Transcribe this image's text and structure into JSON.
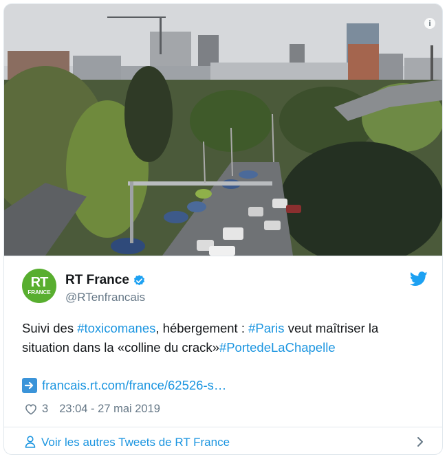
{
  "tweet": {
    "author_name": "RT France",
    "handle": "@RTenfrancais",
    "avatar_text_main": "RT",
    "avatar_text_sub": "FRANCE",
    "text_segments": [
      {
        "text": "Suivi des ",
        "type": "plain"
      },
      {
        "text": "#toxicomanes",
        "type": "hashtag"
      },
      {
        "text": ", hébergement : ",
        "type": "plain"
      },
      {
        "text": "#Paris",
        "type": "hashtag"
      },
      {
        "text": " veut maîtriser la situation dans la «colline du crack»",
        "type": "plain"
      },
      {
        "text": "#PortedeLaChapelle",
        "type": "hashtag"
      }
    ],
    "link_text": "francais.rt.com/france/62526-s…",
    "likes": "3",
    "timestamp": "23:04 - 27 mai 2019",
    "info_glyph": "i"
  },
  "footer": {
    "label": "Voir les autres Tweets de RT France"
  },
  "icons": {
    "info": "info-icon",
    "verified": "verified-badge-icon",
    "twitter": "twitter-bird-icon",
    "link_arrow": "right-arrow-icon",
    "like": "heart-icon",
    "person": "person-icon",
    "chevron": "chevron-right-icon"
  },
  "colors": {
    "brand_blue": "#1b95e0",
    "avatar_green": "#58ae2f",
    "muted_text": "#657786"
  }
}
